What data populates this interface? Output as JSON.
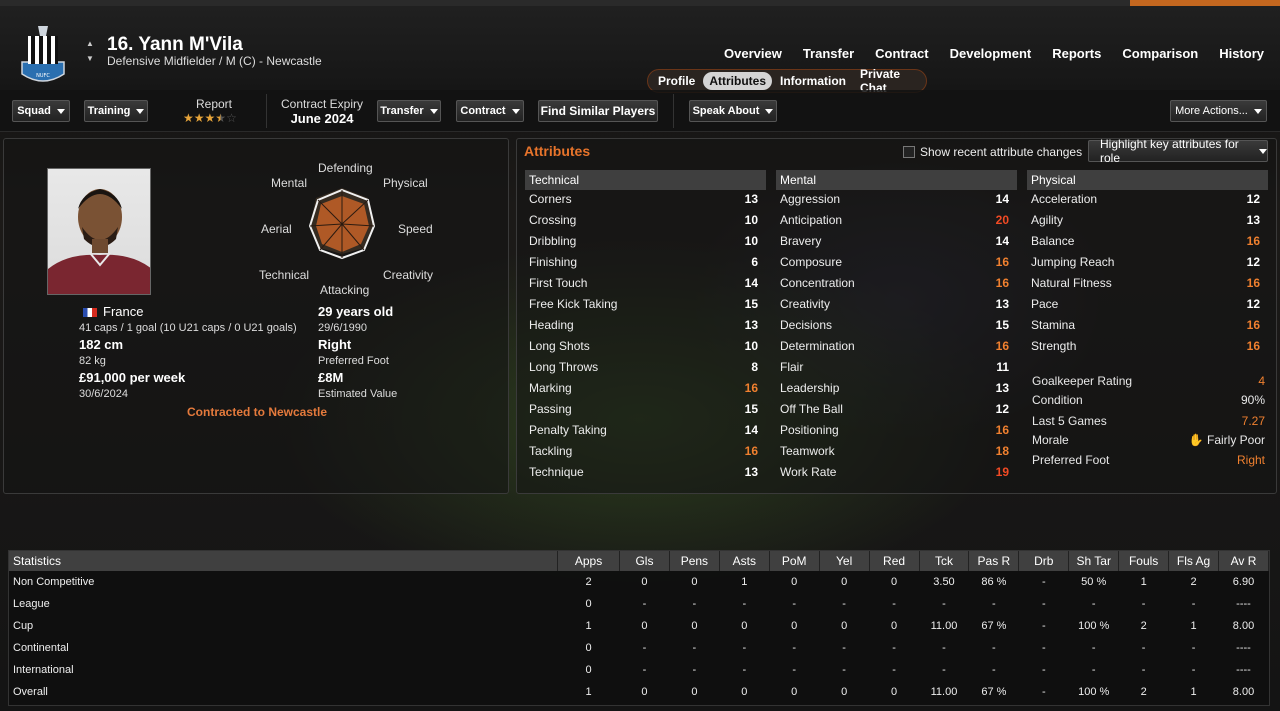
{
  "header": {
    "name": "16. Yann M'Vila",
    "position": "Defensive Midfielder / M (C) - Newcastle",
    "nav": [
      "Overview",
      "Transfer",
      "Contract",
      "Development",
      "Reports",
      "Comparison",
      "History"
    ],
    "subnav": [
      "Profile",
      "Attributes",
      "Information",
      "Private Chat"
    ],
    "active_subnav": "Attributes"
  },
  "toolbar": {
    "squad": "Squad",
    "training": "Training",
    "report_label": "Report",
    "report_stars": 3.5,
    "contract_label": "Contract Expiry",
    "contract_value": "June 2024",
    "transfer": "Transfer",
    "contract": "Contract",
    "find_similar": "Find Similar Players",
    "speak_about": "Speak About",
    "more_actions": "More Actions..."
  },
  "profile": {
    "radar": [
      "Defending",
      "Physical",
      "Speed",
      "Creativity",
      "Attacking",
      "Technical",
      "Aerial",
      "Mental"
    ],
    "nation": "France",
    "caps": "41 caps / 1 goal (10 U21 caps / 0 U21 goals)",
    "height": "182 cm",
    "weight": "82 kg",
    "wage": "£91,000 per week",
    "contract_end": "30/6/2024",
    "age": "29 years old",
    "dob": "29/6/1990",
    "foot": "Right",
    "foot_label": "Preferred Foot",
    "value": "£8M",
    "value_label": "Estimated Value",
    "contracted": "Contracted to Newcastle"
  },
  "attributes": {
    "title": "Attributes",
    "show_changes": "Show recent attribute changes",
    "highlight": "Highlight key attributes for role",
    "technical": {
      "header": "Technical",
      "items": [
        {
          "label": "Corners",
          "value": "13",
          "c": ""
        },
        {
          "label": "Crossing",
          "value": "10",
          "c": ""
        },
        {
          "label": "Dribbling",
          "value": "10",
          "c": ""
        },
        {
          "label": "Finishing",
          "value": "6",
          "c": ""
        },
        {
          "label": "First Touch",
          "value": "14",
          "c": ""
        },
        {
          "label": "Free Kick Taking",
          "value": "15",
          "c": ""
        },
        {
          "label": "Heading",
          "value": "13",
          "c": ""
        },
        {
          "label": "Long Shots",
          "value": "10",
          "c": ""
        },
        {
          "label": "Long Throws",
          "value": "8",
          "c": ""
        },
        {
          "label": "Marking",
          "value": "16",
          "c": "orange"
        },
        {
          "label": "Passing",
          "value": "15",
          "c": ""
        },
        {
          "label": "Penalty Taking",
          "value": "14",
          "c": ""
        },
        {
          "label": "Tackling",
          "value": "16",
          "c": "orange"
        },
        {
          "label": "Technique",
          "value": "13",
          "c": ""
        }
      ]
    },
    "mental": {
      "header": "Mental",
      "items": [
        {
          "label": "Aggression",
          "value": "14",
          "c": ""
        },
        {
          "label": "Anticipation",
          "value": "20",
          "c": "red"
        },
        {
          "label": "Bravery",
          "value": "14",
          "c": ""
        },
        {
          "label": "Composure",
          "value": "16",
          "c": "orange"
        },
        {
          "label": "Concentration",
          "value": "16",
          "c": "orange"
        },
        {
          "label": "Creativity",
          "value": "13",
          "c": ""
        },
        {
          "label": "Decisions",
          "value": "15",
          "c": ""
        },
        {
          "label": "Determination",
          "value": "16",
          "c": "orange"
        },
        {
          "label": "Flair",
          "value": "11",
          "c": ""
        },
        {
          "label": "Leadership",
          "value": "13",
          "c": ""
        },
        {
          "label": "Off The Ball",
          "value": "12",
          "c": ""
        },
        {
          "label": "Positioning",
          "value": "16",
          "c": "orange"
        },
        {
          "label": "Teamwork",
          "value": "18",
          "c": "orange"
        },
        {
          "label": "Work Rate",
          "value": "19",
          "c": "red"
        }
      ]
    },
    "physical": {
      "header": "Physical",
      "items": [
        {
          "label": "Acceleration",
          "value": "12",
          "c": ""
        },
        {
          "label": "Agility",
          "value": "13",
          "c": ""
        },
        {
          "label": "Balance",
          "value": "16",
          "c": "orange"
        },
        {
          "label": "Jumping Reach",
          "value": "12",
          "c": ""
        },
        {
          "label": "Natural Fitness",
          "value": "16",
          "c": "orange"
        },
        {
          "label": "Pace",
          "value": "12",
          "c": ""
        },
        {
          "label": "Stamina",
          "value": "16",
          "c": "orange"
        },
        {
          "label": "Strength",
          "value": "16",
          "c": "orange"
        }
      ]
    },
    "extra": [
      {
        "label": "Goalkeeper Rating",
        "value": "4",
        "c": "orange"
      },
      {
        "label": "Condition",
        "value": "90%",
        "c": ""
      },
      {
        "label": "Last 5 Games",
        "value": "7.27",
        "c": "orange"
      },
      {
        "label": "Morale",
        "value": "Fairly Poor",
        "c": ""
      },
      {
        "label": "Preferred Foot",
        "value": "Right",
        "c": "orange"
      }
    ]
  },
  "stats": {
    "headers": [
      "Statistics",
      "Apps",
      "Gls",
      "Pens",
      "Asts",
      "PoM",
      "Yel",
      "Red",
      "Tck",
      "Pas R",
      "Drb",
      "Sh Tar",
      "Fouls",
      "Fls Ag",
      "Av R"
    ],
    "rows": [
      [
        "Non Competitive",
        "2",
        "0",
        "0",
        "1",
        "0",
        "0",
        "0",
        "3.50",
        "86 %",
        "-",
        "50 %",
        "1",
        "2",
        "6.90"
      ],
      [
        "League",
        "0",
        "-",
        "-",
        "-",
        "-",
        "-",
        "-",
        "-",
        "-",
        "-",
        "-",
        "-",
        "-",
        "----"
      ],
      [
        "Cup",
        "1",
        "0",
        "0",
        "0",
        "0",
        "0",
        "0",
        "11.00",
        "67 %",
        "-",
        "100 %",
        "2",
        "1",
        "8.00"
      ],
      [
        "Continental",
        "0",
        "-",
        "-",
        "-",
        "-",
        "-",
        "-",
        "-",
        "-",
        "-",
        "-",
        "-",
        "-",
        "----"
      ],
      [
        "International",
        "0",
        "-",
        "-",
        "-",
        "-",
        "-",
        "-",
        "-",
        "-",
        "-",
        "-",
        "-",
        "-",
        "----"
      ],
      [
        "Overall",
        "1",
        "0",
        "0",
        "0",
        "0",
        "0",
        "0",
        "11.00",
        "67 %",
        "-",
        "100 %",
        "2",
        "1",
        "8.00"
      ]
    ]
  }
}
